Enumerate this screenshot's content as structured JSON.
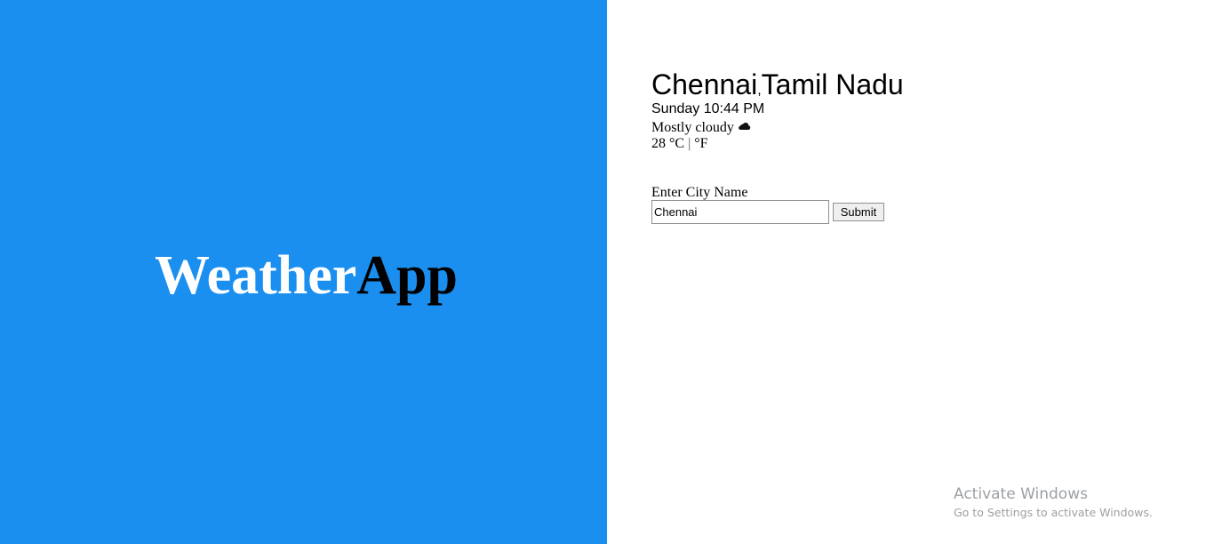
{
  "brand": {
    "part1": "Weather",
    "part2": "App"
  },
  "weather": {
    "city": "Chennai",
    "separator": ",",
    "region": "Tamil Nadu",
    "datetime": "Sunday 10:44 PM",
    "condition": "Mostly cloudy",
    "condition_icon": "cloud-icon",
    "temperature": "28",
    "unit_c": "°C",
    "unit_sep": "|",
    "unit_f": "°F"
  },
  "form": {
    "label": "Enter City Name",
    "input_value": "Chennai",
    "submit_label": "Submit"
  },
  "watermark": {
    "title": "Activate Windows",
    "subtitle": "Go to Settings to activate Windows."
  },
  "colors": {
    "left_panel": "#1a8fef",
    "brand_primary": "#ffffff",
    "brand_secondary": "#000000"
  }
}
